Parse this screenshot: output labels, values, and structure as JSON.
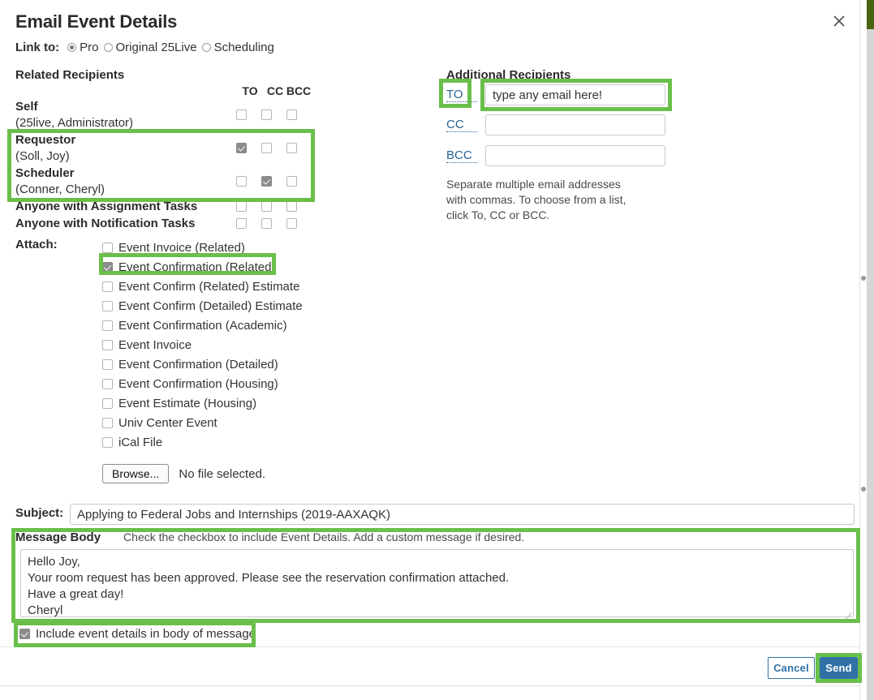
{
  "dialog": {
    "title": "Email Event Details",
    "close_icon": "close-icon"
  },
  "link_to": {
    "label": "Link to:",
    "options": [
      {
        "label": "Pro",
        "selected": true
      },
      {
        "label": "Original 25Live",
        "selected": false
      },
      {
        "label": "Scheduling",
        "selected": false
      }
    ]
  },
  "related_recipients": {
    "title": "Related Recipients",
    "columns": [
      "TO",
      "CC",
      "BCC"
    ],
    "rows": [
      {
        "name": "Self",
        "sub": "(25live, Administrator)",
        "to": false,
        "cc": false,
        "bcc": false
      },
      {
        "name": "Requestor",
        "sub": "(Soll, Joy)",
        "to": true,
        "cc": false,
        "bcc": false
      },
      {
        "name": "Scheduler",
        "sub": "(Conner, Cheryl)",
        "to": false,
        "cc": true,
        "bcc": false
      },
      {
        "name": "Anyone with Assignment Tasks",
        "sub": "",
        "to": false,
        "cc": false,
        "bcc": false
      },
      {
        "name": "Anyone with Notification Tasks",
        "sub": "",
        "to": false,
        "cc": false,
        "bcc": false
      }
    ]
  },
  "attach": {
    "label": "Attach:",
    "items": [
      {
        "label": "Event Invoice (Related)",
        "checked": false
      },
      {
        "label": "Event Confirmation (Related)",
        "checked": true
      },
      {
        "label": "Event Confirm (Related) Estimate",
        "checked": false
      },
      {
        "label": "Event Confirm (Detailed) Estimate",
        "checked": false
      },
      {
        "label": "Event Confirmation (Academic)",
        "checked": false
      },
      {
        "label": "Event Invoice",
        "checked": false
      },
      {
        "label": "Event Confirmation (Detailed)",
        "checked": false
      },
      {
        "label": "Event Confirmation (Housing)",
        "checked": false
      },
      {
        "label": "Event Estimate (Housing)",
        "checked": false
      },
      {
        "label": "Univ Center Event",
        "checked": false
      },
      {
        "label": "iCal File",
        "checked": false
      }
    ],
    "browse_button": "Browse...",
    "file_status": "No file selected."
  },
  "additional_recipients": {
    "title": "Additional Recipients",
    "rows": [
      {
        "link": "TO",
        "value": "type any email here!",
        "placeholder": ""
      },
      {
        "link": "CC",
        "value": "",
        "placeholder": ""
      },
      {
        "link": "BCC",
        "value": "",
        "placeholder": ""
      }
    ],
    "hint": "Separate multiple email addresses with commas. To choose from a list, click To, CC or BCC."
  },
  "subject": {
    "label": "Subject:",
    "value": "Applying to Federal Jobs and Internships (2019-AAXAQK)",
    "placeholder": ""
  },
  "message_body": {
    "title": "Message Body",
    "hint": "Check the checkbox to include Event Details. Add a custom message if desired.",
    "value": "Hello Joy,\nYour room request has been approved. Please see the reservation confirmation attached.\nHave a great day!\nCheryl",
    "include_details_label": "Include event details in body of message",
    "include_details_checked": true
  },
  "footer": {
    "cancel_label": "Cancel",
    "send_label": "Send"
  },
  "colors": {
    "highlight": "#6abf4b",
    "primary_button": "#3072a6",
    "link": "#2a6496",
    "checkbox_checked": "#8b8b8b",
    "scrollbar_thumb": "#4a6413"
  }
}
